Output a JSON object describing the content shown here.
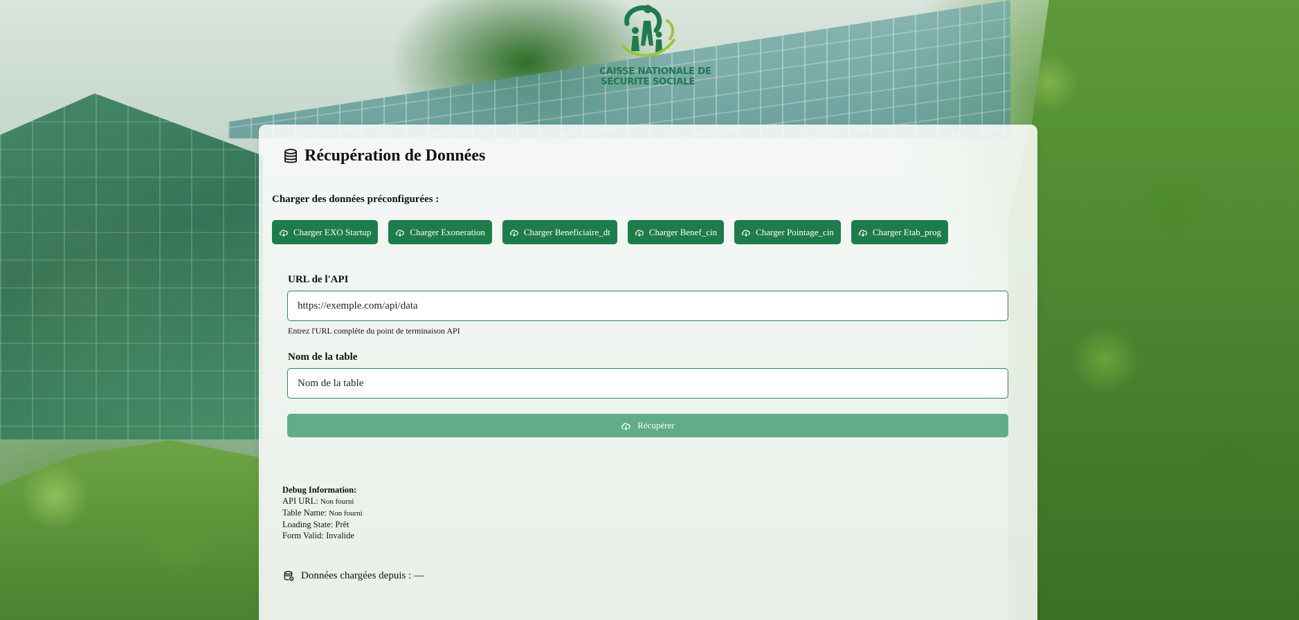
{
  "logo": {
    "alt_lines": [
      "CAISSE NATIONALE DE",
      "SECURITE SOCIALE"
    ]
  },
  "colors": {
    "primary_green": "#1e7c4a",
    "disabled_green": "#62ad87",
    "input_border": "#2a8458"
  },
  "card": {
    "title": "Récupération de Données",
    "title_icon": "database-icon"
  },
  "preconfig": {
    "label": "Charger des données préconfigurées :",
    "buttons": [
      {
        "label": "Charger EXO Startup",
        "icon": "cloud-download-icon"
      },
      {
        "label": "Charger Exoneration",
        "icon": "cloud-download-icon"
      },
      {
        "label": "Charger Beneficiaire_dt",
        "icon": "cloud-download-icon"
      },
      {
        "label": "Charger Benef_cin",
        "icon": "cloud-download-icon"
      },
      {
        "label": "Charger Pointage_cin",
        "icon": "cloud-download-icon"
      },
      {
        "label": "Charger Etab_prog",
        "icon": "cloud-download-icon"
      }
    ]
  },
  "form": {
    "api_url": {
      "label": "URL de l'API",
      "placeholder": "https://exemple.com/api/data",
      "value": "",
      "help": "Entrez l'URL complète du point de terminaison API"
    },
    "table_name": {
      "label": "Nom de la table",
      "placeholder": "Nom de la table",
      "value": ""
    },
    "submit": {
      "label": "Récupérer",
      "icon": "cloud-download-icon",
      "disabled": true
    }
  },
  "debug": {
    "title": "Debug Information:",
    "rows": [
      {
        "key": "API URL:",
        "value": "Non fourni"
      },
      {
        "key": "Table Name:",
        "value": "Non fourni"
      },
      {
        "key": "Loading State:",
        "value": "Prêt"
      },
      {
        "key": "Form Valid:",
        "value": "Invalide"
      }
    ]
  },
  "loaded_from": {
    "icon": "database-gear-icon",
    "text": "Données chargées depuis : —"
  }
}
